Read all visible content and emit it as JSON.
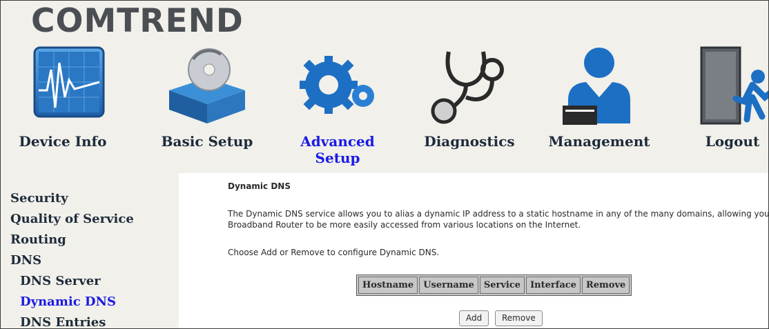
{
  "logo": "COMTREND",
  "nav": [
    {
      "label": "Device Info",
      "icon": "device-info-icon"
    },
    {
      "label": "Basic Setup",
      "icon": "basic-setup-icon"
    },
    {
      "label": "Advanced Setup",
      "icon": "advanced-setup-icon",
      "active": true
    },
    {
      "label": "Diagnostics",
      "icon": "diagnostics-icon"
    },
    {
      "label": "Management",
      "icon": "management-icon"
    },
    {
      "label": "Logout",
      "icon": "logout-icon"
    }
  ],
  "sidebar": {
    "items": [
      {
        "label": "Security"
      },
      {
        "label": "Quality of Service"
      },
      {
        "label": "Routing"
      },
      {
        "label": "DNS"
      },
      {
        "label": "DNS Server"
      },
      {
        "label": "Dynamic DNS",
        "selected": true
      },
      {
        "label": "DNS Entries"
      }
    ]
  },
  "main": {
    "title": "Dynamic DNS",
    "description": "The Dynamic DNS service allows you to alias a dynamic IP address to a static hostname in any of the many domains, allowing your Broadband Router to be more easily accessed from various locations on the Internet.",
    "instruction": "Choose Add or Remove to configure Dynamic DNS.",
    "table_headers": [
      "Hostname",
      "Username",
      "Service",
      "Interface",
      "Remove"
    ],
    "buttons": {
      "add": "Add",
      "remove": "Remove"
    }
  },
  "colors": {
    "active_link": "#1a1ae6",
    "page_bg": "#f1f0ea",
    "text_dark": "#1d2b3a"
  }
}
